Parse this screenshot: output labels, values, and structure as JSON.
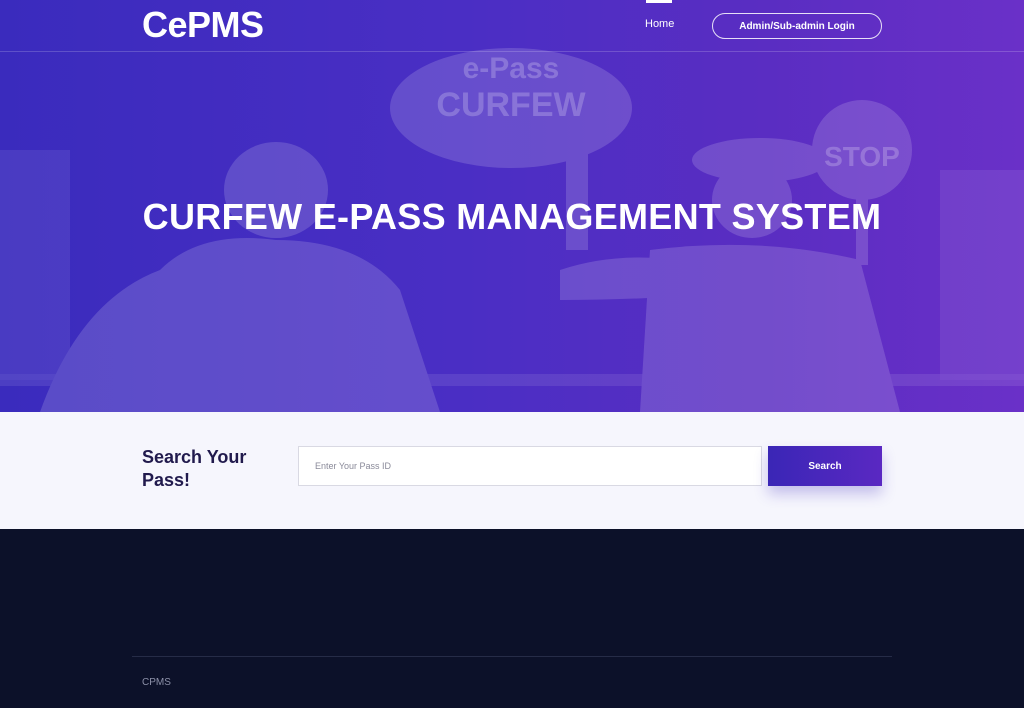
{
  "header": {
    "logo": "CePMS",
    "nav_home": "Home",
    "login_button": "Admin/Sub-admin Login"
  },
  "hero": {
    "title": "CURFEW E-PASS MANAGEMENT SYSTEM",
    "sign_line1": "e-Pass",
    "sign_line2": "CURFEW",
    "stop_sign": "STOP"
  },
  "search": {
    "heading": "Search Your Pass!",
    "placeholder": "Enter Your Pass ID",
    "value": "",
    "button": "Search"
  },
  "footer": {
    "text": "CPMS"
  },
  "colors": {
    "hero_gradient_start": "#3a2bbd",
    "hero_gradient_end": "#6a30c8",
    "search_bg": "#f6f6fd",
    "footer_bg": "#0c1129",
    "accent": "#4a28c0"
  }
}
